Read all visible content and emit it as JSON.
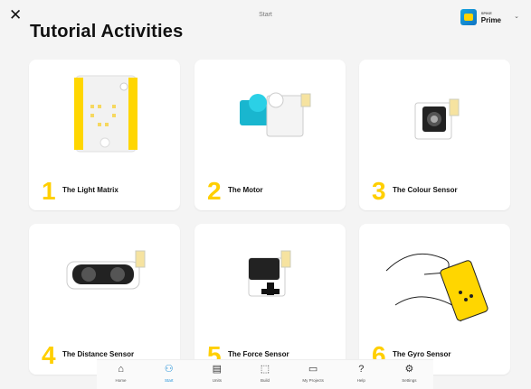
{
  "header": {
    "close_glyph": "✕",
    "top_title": "Start",
    "hub": {
      "small": "SPIKE",
      "main": "Prime",
      "chevron": "⌄"
    },
    "page_title": "Tutorial Activities"
  },
  "cards": [
    {
      "number": "1",
      "label": "The Light Matrix"
    },
    {
      "number": "2",
      "label": "The Motor"
    },
    {
      "number": "3",
      "label": "The Colour Sensor"
    },
    {
      "number": "4",
      "label": "The Distance Sensor"
    },
    {
      "number": "5",
      "label": "The Force Sensor"
    },
    {
      "number": "6",
      "label": "The Gyro Sensor"
    }
  ],
  "nav": [
    {
      "label": "Home",
      "icon": "home-icon",
      "active": false
    },
    {
      "label": "Start",
      "icon": "start-icon",
      "active": true
    },
    {
      "label": "Units",
      "icon": "units-icon",
      "active": false
    },
    {
      "label": "Build",
      "icon": "build-icon",
      "active": false
    },
    {
      "label": "My Projects",
      "icon": "projects-icon",
      "active": false
    },
    {
      "label": "Help",
      "icon": "help-icon",
      "active": false
    },
    {
      "label": "Settings",
      "icon": "settings-icon",
      "active": false
    }
  ],
  "colors": {
    "accent": "#1e8fd8",
    "number_yellow": "#ffcf00",
    "hub_blue": "#18a6e0"
  }
}
